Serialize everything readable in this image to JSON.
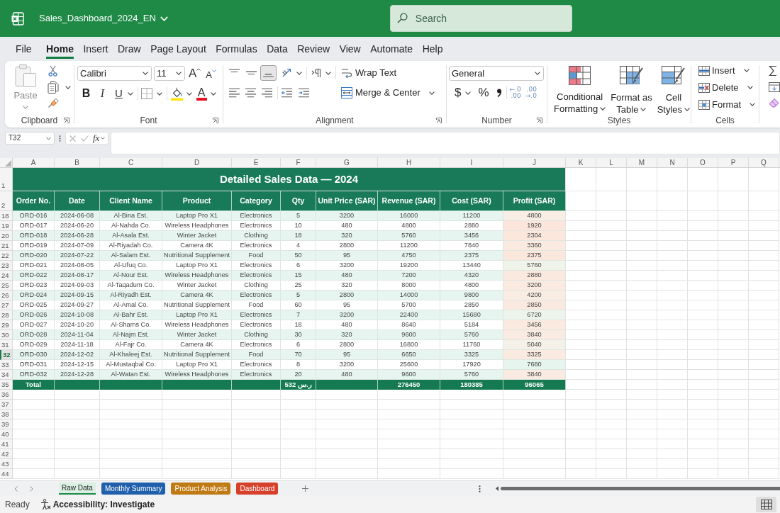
{
  "title_bar": {
    "file_name": "Sales_Dashboard_2024_EN",
    "search": {
      "placeholder": "Search"
    }
  },
  "menu_tabs": [
    {
      "label": "File",
      "selected": false
    },
    {
      "label": "Home",
      "selected": true
    },
    {
      "label": "Insert",
      "selected": false
    },
    {
      "label": "Draw",
      "selected": false
    },
    {
      "label": "Page Layout",
      "selected": false
    },
    {
      "label": "Formulas",
      "selected": false
    },
    {
      "label": "Data",
      "selected": false
    },
    {
      "label": "Review",
      "selected": false
    },
    {
      "label": "View",
      "selected": false
    },
    {
      "label": "Automate",
      "selected": false
    },
    {
      "label": "Help",
      "selected": false
    }
  ],
  "ribbon": {
    "clipboard": {
      "paste": {
        "label": "Paste",
        "disabled": true
      },
      "label": "Clipboard"
    },
    "font": {
      "font_name": "Calibri",
      "font_size": "11",
      "grow_font": "A",
      "shrink_font": "A",
      "bold": "B",
      "italic": "I",
      "underline": "U",
      "font_color": "A",
      "label": "Font"
    },
    "alignment": {
      "vertical_align": [
        {
          "kind": "top",
          "selected": false
        },
        {
          "kind": "middle",
          "selected": false
        },
        {
          "kind": "bottom",
          "selected": true
        }
      ],
      "wrap_text": "Wrap Text",
      "merge_center": "Merge & Center",
      "label": "Alignment"
    },
    "number": {
      "format": "General",
      "currency": "$",
      "percent": "%",
      "increase_decimal": [
        "←.0",
        ".00"
      ],
      "decrease_decimal": [
        ".00",
        "→.0"
      ],
      "label": "Number"
    },
    "styles": {
      "buttons": [
        {
          "kind": "conditional_formatting",
          "lines": [
            "Conditional",
            "Formatting"
          ]
        },
        {
          "kind": "format_as_table",
          "lines": [
            "Format as",
            "Table"
          ]
        },
        {
          "kind": "cell_styles",
          "lines": [
            "Cell",
            "Styles"
          ]
        }
      ],
      "label": "Styles"
    },
    "cells": {
      "buttons": [
        {
          "kind": "insert",
          "label": "Insert"
        },
        {
          "kind": "delete",
          "label": "Delete"
        },
        {
          "kind": "format",
          "label": "Format"
        }
      ],
      "label": "Cells"
    }
  },
  "formula_bar": {
    "name_box": "T32",
    "function_label": "fx"
  },
  "sheet": {
    "columns": [
      "A",
      "B",
      "C",
      "D",
      "E",
      "F",
      "G",
      "H",
      "I",
      "J",
      "K",
      "L",
      "M",
      "N",
      "O",
      "P",
      "Q"
    ],
    "title_row_number": "1",
    "header_row_number": "2",
    "title": "Detailed Sales Data — 2024",
    "headers": [
      "Order No.",
      "Date",
      "Client Name",
      "Product",
      "Category",
      "Qty",
      "Unit Price (SAR)",
      "Revenue (SAR)",
      "Cost (SAR)",
      "Profit (SAR)"
    ],
    "rows": [
      {
        "number": "18",
        "selected": false,
        "cells": [
          "ORD-016",
          "2024-06-08",
          "Al-Bina Est.",
          "Laptop Pro X1",
          "Electronics",
          "5",
          "3200",
          "16000",
          "11200"
        ],
        "profit": {
          "value": "4800",
          "color": "#f8eee6"
        }
      },
      {
        "number": "19",
        "selected": false,
        "cells": [
          "ORD-017",
          "2024-06-20",
          "Al-Nahda Co.",
          "Wireless Headphones",
          "Electronics",
          "10",
          "480",
          "4800",
          "2880"
        ],
        "profit": {
          "value": "1920",
          "color": "#fce6dc"
        }
      },
      {
        "number": "20",
        "selected": false,
        "cells": [
          "ORD-018",
          "2024-06-28",
          "Al-Asala Est.",
          "Winter Jacket",
          "Clothing",
          "18",
          "320",
          "5760",
          "3456"
        ],
        "profit": {
          "value": "2304",
          "color": "#fbe7dc"
        }
      },
      {
        "number": "21",
        "selected": false,
        "cells": [
          "ORD-019",
          "2024-07-09",
          "Al-Riyadah Co.",
          "Camera 4K",
          "Electronics",
          "4",
          "2800",
          "11200",
          "7840"
        ],
        "profit": {
          "value": "3360",
          "color": "#faeadf"
        }
      },
      {
        "number": "22",
        "selected": false,
        "cells": [
          "ORD-020",
          "2024-07-22",
          "Al-Salam Est.",
          "Nutritional Supplement",
          "Food",
          "50",
          "95",
          "4750",
          "2375"
        ],
        "profit": {
          "value": "2375",
          "color": "#fbe7dc"
        }
      },
      {
        "number": "23",
        "selected": false,
        "cells": [
          "ORD-021",
          "2024-08-05",
          "Al-Ufuq Co.",
          "Laptop Pro X1",
          "Electronics",
          "6",
          "3200",
          "19200",
          "13440"
        ],
        "profit": {
          "value": "5760",
          "color": "#f0f3ea"
        }
      },
      {
        "number": "24",
        "selected": false,
        "cells": [
          "ORD-022",
          "2024-08-17",
          "Al-Nour Est.",
          "Wireless Headphones",
          "Electronics",
          "15",
          "480",
          "7200",
          "4320"
        ],
        "profit": {
          "value": "2880",
          "color": "#fae9de"
        }
      },
      {
        "number": "25",
        "selected": false,
        "cells": [
          "ORD-023",
          "2024-09-03",
          "Al-Taqadum Co.",
          "Winter Jacket",
          "Clothing",
          "25",
          "320",
          "8000",
          "4800"
        ],
        "profit": {
          "value": "3200",
          "color": "#faeadf"
        }
      },
      {
        "number": "26",
        "selected": false,
        "cells": [
          "ORD-024",
          "2024-09-15",
          "Al-Riyadh Est.",
          "Camera 4K",
          "Electronics",
          "5",
          "2800",
          "14000",
          "9800"
        ],
        "profit": {
          "value": "4200",
          "color": "#f9ede3"
        }
      },
      {
        "number": "27",
        "selected": false,
        "cells": [
          "ORD-025",
          "2024-09-27",
          "Al-Amal Co.",
          "Nutritional Supplement",
          "Food",
          "60",
          "95",
          "5700",
          "2850"
        ],
        "profit": {
          "value": "2850",
          "color": "#fae9de"
        }
      },
      {
        "number": "28",
        "selected": false,
        "cells": [
          "ORD-026",
          "2024-10-08",
          "Al-Bahr Est.",
          "Laptop Pro X1",
          "Electronics",
          "7",
          "3200",
          "22400",
          "15680"
        ],
        "profit": {
          "value": "6720",
          "color": "#ecf4ec"
        }
      },
      {
        "number": "29",
        "selected": false,
        "cells": [
          "ORD-027",
          "2024-10-20",
          "Al-Shams Co.",
          "Wireless Headphones",
          "Electronics",
          "18",
          "480",
          "8640",
          "5184"
        ],
        "profit": {
          "value": "3456",
          "color": "#faeadf"
        }
      },
      {
        "number": "30",
        "selected": false,
        "cells": [
          "ORD-028",
          "2024-11-04",
          "Al-Najm Est.",
          "Winter Jacket",
          "Clothing",
          "30",
          "320",
          "9600",
          "5760"
        ],
        "profit": {
          "value": "3840",
          "color": "#f9ebe1"
        }
      },
      {
        "number": "31",
        "selected": false,
        "cells": [
          "ORD-029",
          "2024-11-18",
          "Al-Fajr Co.",
          "Camera 4K",
          "Electronics",
          "6",
          "2800",
          "16800",
          "11760"
        ],
        "profit": {
          "value": "5040",
          "color": "#f4f1e8"
        }
      },
      {
        "number": "32",
        "selected": true,
        "cells": [
          "ORD-030",
          "2024-12-02",
          "Al-Khaleej Est.",
          "Nutritional Supplement",
          "Food",
          "70",
          "95",
          "6650",
          "3325"
        ],
        "profit": {
          "value": "3325",
          "color": "#faeadf"
        }
      },
      {
        "number": "33",
        "selected": false,
        "cells": [
          "ORD-031",
          "2024-12-15",
          "Al-Mustaqbal Co.",
          "Laptop Pro X1",
          "Electronics",
          "8",
          "3200",
          "25600",
          "17920"
        ],
        "profit": {
          "value": "7680",
          "color": "#e6f5ee"
        }
      },
      {
        "number": "34",
        "selected": false,
        "cells": [
          "ORD-032",
          "2024-12-28",
          "Al-Watan Est.",
          "Wireless Headphones",
          "Electronics",
          "20",
          "480",
          "9600",
          "5760"
        ],
        "profit": {
          "value": "3840",
          "color": "#f9ebe1"
        }
      }
    ],
    "total": {
      "number": "35",
      "label": "Total",
      "qty": "532 ر.س",
      "revenue": "276450",
      "cost": "180385",
      "profit": "96065"
    },
    "empty_rows": [
      "36",
      "37",
      "38",
      "39",
      "40",
      "41",
      "42",
      "43",
      "44"
    ]
  },
  "sheet_tabs": [
    {
      "label": "Raw Data",
      "selected": true,
      "color": "#1e8a46"
    },
    {
      "label": "Monthly Summary",
      "selected": false,
      "color": "#1f5fab"
    },
    {
      "label": "Product Analysis",
      "selected": false,
      "color": "#c07a14"
    },
    {
      "label": "Dashboard",
      "selected": false,
      "color": "#d6402a"
    }
  ],
  "status_bar": {
    "status": "Ready",
    "accessibility": "Accessibility: Investigate",
    "view_button": {
      "selected": true
    }
  }
}
